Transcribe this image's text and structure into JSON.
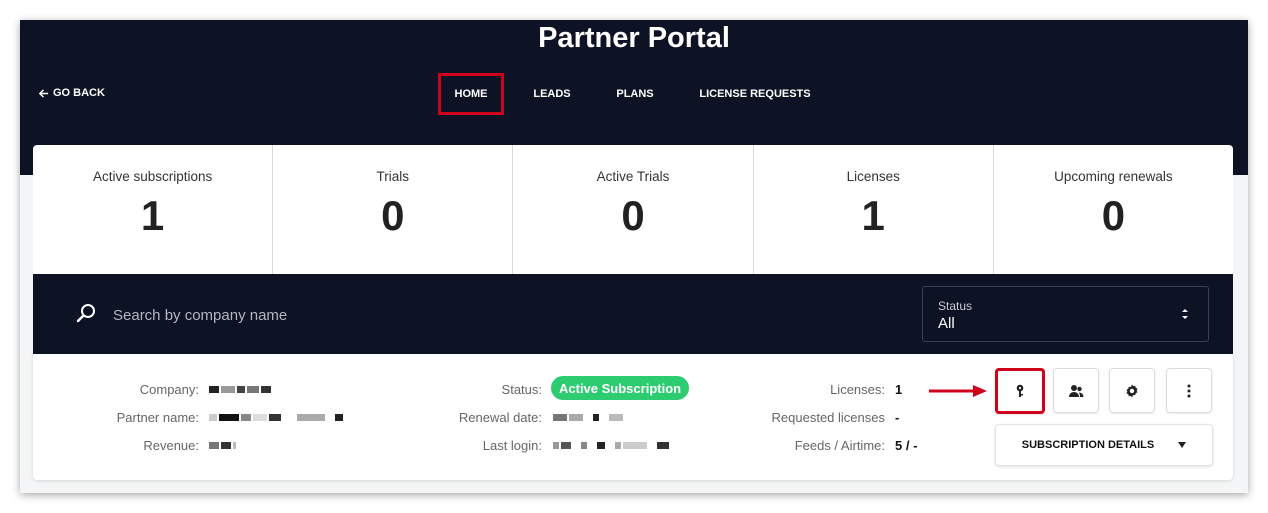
{
  "header": {
    "title": "Partner Portal",
    "go_back_label": "GO BACK",
    "nav": {
      "home": "HOME",
      "leads": "LEADS",
      "plans": "PLANS",
      "license_requests": "LICENSE REQUESTS"
    }
  },
  "stats": [
    {
      "label": "Active subscriptions",
      "value": "1"
    },
    {
      "label": "Trials",
      "value": "0"
    },
    {
      "label": "Active Trials",
      "value": "0"
    },
    {
      "label": "Licenses",
      "value": "1"
    },
    {
      "label": "Upcoming renewals",
      "value": "0"
    }
  ],
  "search": {
    "placeholder": "Search by company name",
    "status_label": "Status",
    "status_value": "All"
  },
  "subscription": {
    "company_label": "Company:",
    "partner_name_label": "Partner name:",
    "revenue_label": "Revenue:",
    "status_label": "Status:",
    "status_value": "Active Subscription",
    "renewal_date_label": "Renewal date:",
    "last_login_label": "Last login:",
    "licenses_label": "Licenses:",
    "licenses_value": "1",
    "requested_licenses_label": "Requested licenses",
    "requested_licenses_value": "-",
    "feeds_label": "Feeds / Airtime:",
    "feeds_value": "5 / -",
    "details_button": "SUBSCRIPTION DETAILS"
  },
  "colors": {
    "navy": "#0d1224",
    "highlight_red": "#d0021b",
    "badge_green": "#2ecc71"
  }
}
